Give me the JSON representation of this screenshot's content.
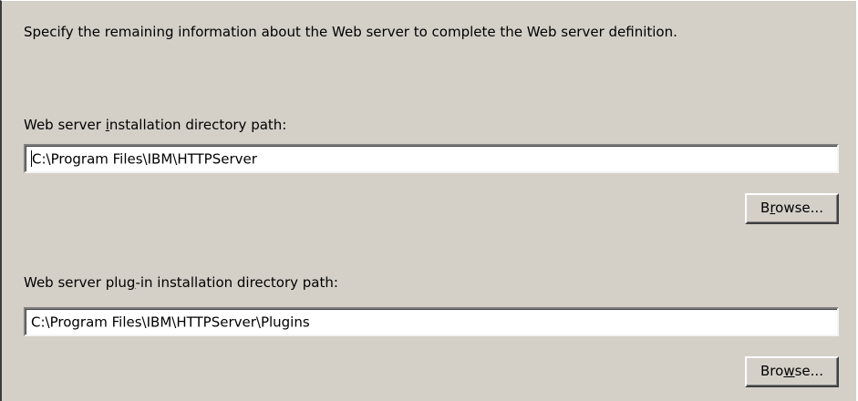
{
  "description": "Specify the remaining information about the Web server to complete the Web server definition.",
  "install_dir": {
    "label_pre": "Web server ",
    "label_mnemonic": "i",
    "label_post": "nstallation directory path:",
    "value": "C:\\Program Files\\IBM\\HTTPServer",
    "browse_pre": "B",
    "browse_mnemonic": "r",
    "browse_post": "owse..."
  },
  "plugin_dir": {
    "label_pre": "Web server plu",
    "label_mnemonic": "g",
    "label_post": "-in installation directory path:",
    "value": "C:\\Program Files\\IBM\\HTTPServer\\Plugins",
    "browse_pre": "Bro",
    "browse_mnemonic": "w",
    "browse_post": "se..."
  }
}
